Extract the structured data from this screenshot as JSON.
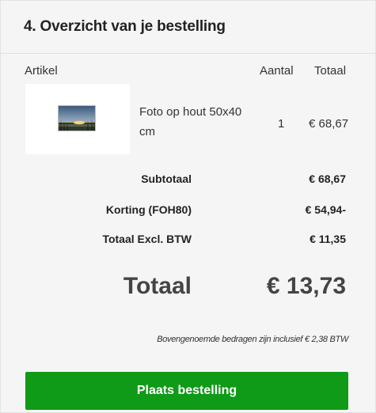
{
  "panel": {
    "title": "4. Overzicht van je bestelling"
  },
  "columns": {
    "artikel": "Artikel",
    "aantal": "Aantal",
    "totaal": "Totaal"
  },
  "items": [
    {
      "name": "Foto op hout 50x40 cm",
      "quantity": "1",
      "total": "€ 68,67",
      "thumbnail_icon": "sunset-landscape-photo"
    }
  ],
  "summary": {
    "subtotal_label": "Subtotaal",
    "subtotal_value": "€ 68,67",
    "discount_label": "Korting (FOH80)",
    "discount_value": "€ 54,94-",
    "excl_label": "Totaal Excl. BTW",
    "excl_value": "€ 11,35",
    "total_label": "Totaal",
    "total_value": "€ 13,73"
  },
  "note": "Bovengenoemde bedragen zijn inclusief € 2,38 BTW",
  "order_button": {
    "label": "Plaats bestelling",
    "color": "#0f9a17"
  }
}
